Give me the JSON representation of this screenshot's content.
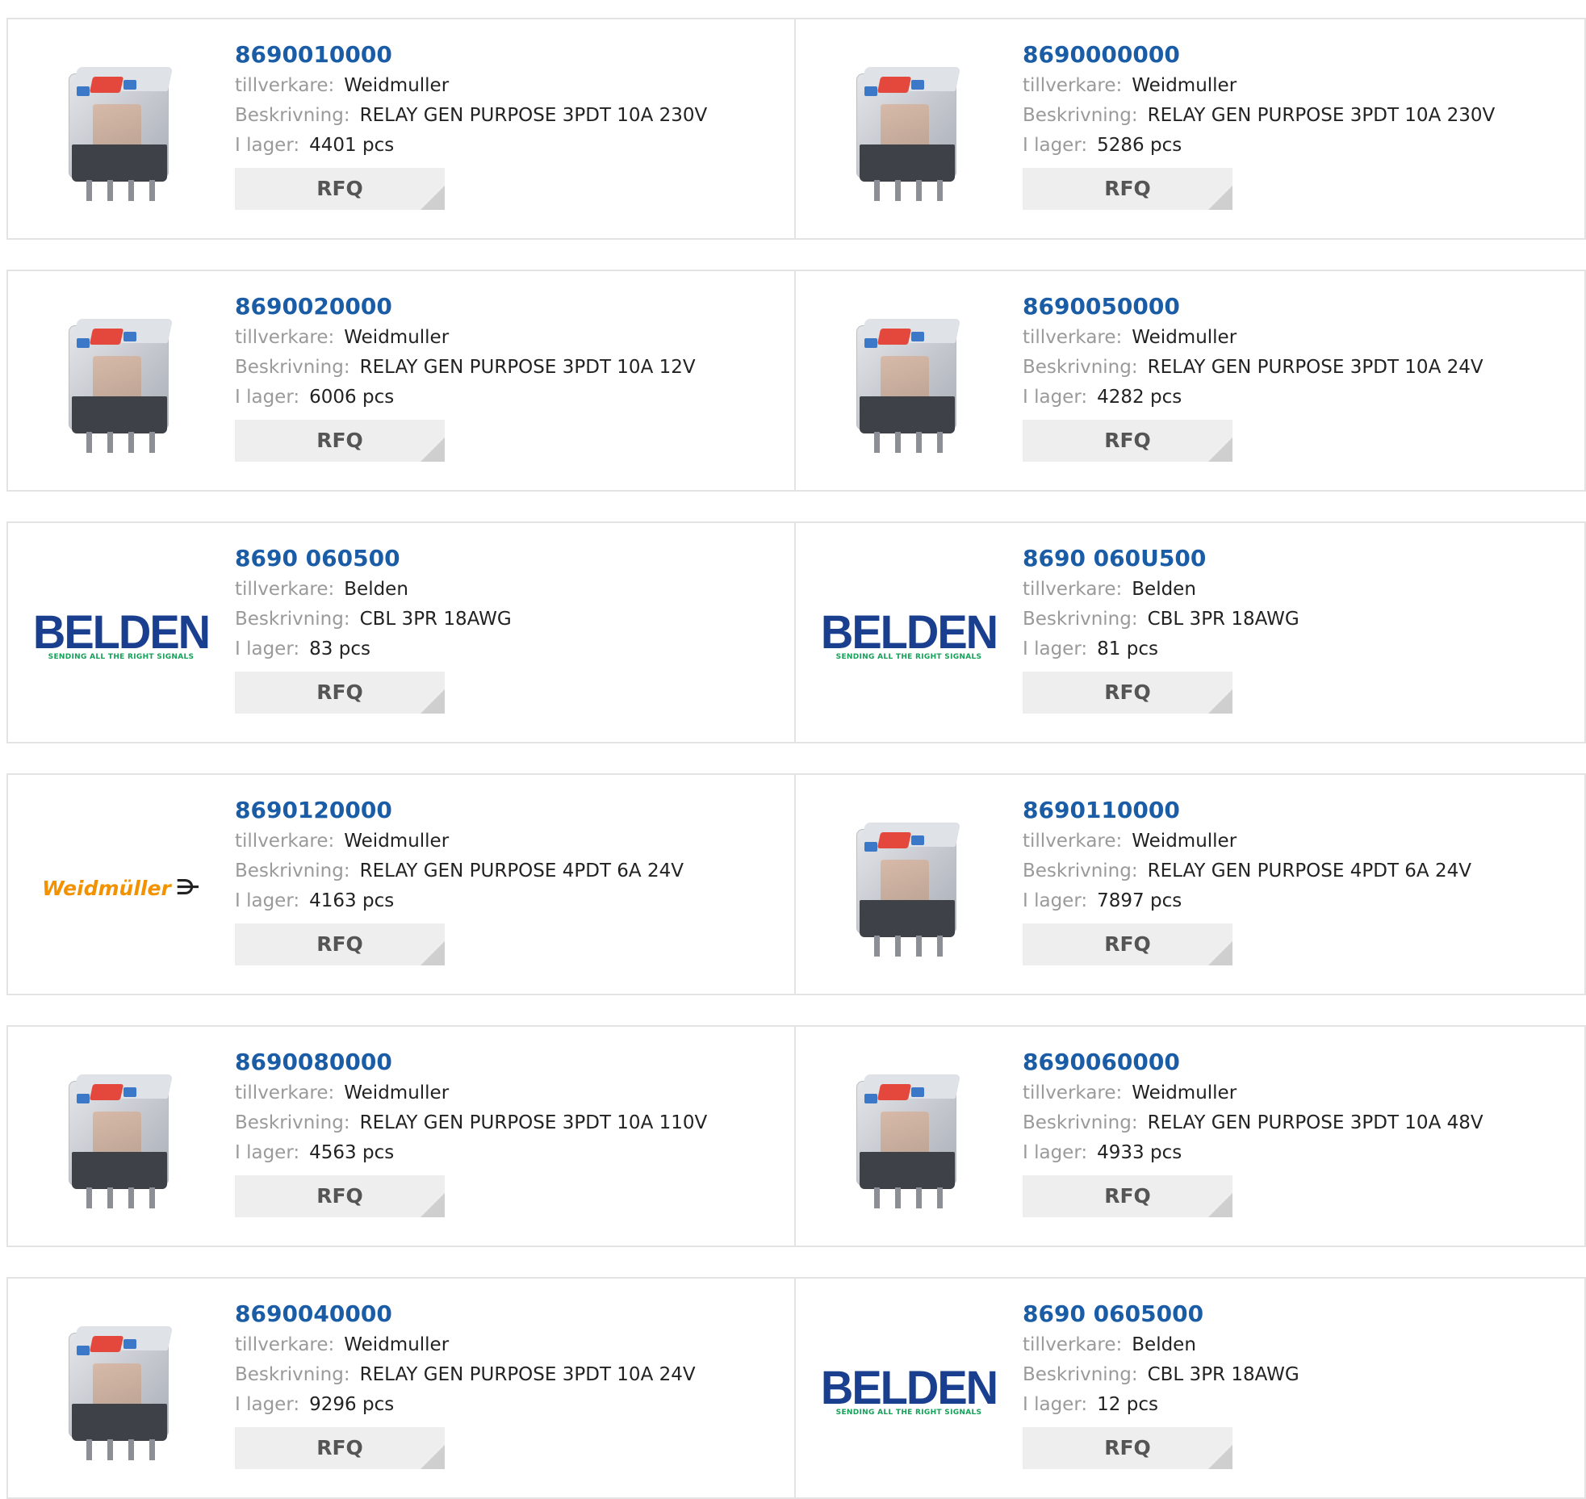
{
  "labels": {
    "manufacturer": "tillverkare:",
    "description": "Beskrivning:",
    "stock": "I lager:"
  },
  "rfq_label": "RFQ",
  "logos": {
    "belden_name": "BELDEN",
    "belden_tagline": "SENDING ALL THE RIGHT SIGNALS",
    "weidmuller_name": "Weidmüller",
    "weidmuller_symbol": "⋺"
  },
  "colors": {
    "part_link": "#1a5da6",
    "rfq_bg": "#eeeeee",
    "border": "#e3e3e3"
  },
  "products": [
    {
      "part": "8690010000",
      "manufacturer": "Weidmuller",
      "description": "RELAY GEN PURPOSE 3PDT 10A 230V",
      "stock": "4401 pcs",
      "image": "relay"
    },
    {
      "part": "8690000000",
      "manufacturer": "Weidmuller",
      "description": "RELAY GEN PURPOSE 3PDT 10A 230V",
      "stock": "5286 pcs",
      "image": "relay"
    },
    {
      "part": "8690020000",
      "manufacturer": "Weidmuller",
      "description": "RELAY GEN PURPOSE 3PDT 10A 12V",
      "stock": "6006 pcs",
      "image": "relay"
    },
    {
      "part": "8690050000",
      "manufacturer": "Weidmuller",
      "description": "RELAY GEN PURPOSE 3PDT 10A 24V",
      "stock": "4282 pcs",
      "image": "relay"
    },
    {
      "part": "8690 060500",
      "manufacturer": "Belden",
      "description": "CBL 3PR 18AWG",
      "stock": "83 pcs",
      "image": "belden"
    },
    {
      "part": "8690 060U500",
      "manufacturer": "Belden",
      "description": "CBL 3PR 18AWG",
      "stock": "81 pcs",
      "image": "belden"
    },
    {
      "part": "8690120000",
      "manufacturer": "Weidmuller",
      "description": "RELAY GEN PURPOSE 4PDT 6A 24V",
      "stock": "4163 pcs",
      "image": "weidmuller"
    },
    {
      "part": "8690110000",
      "manufacturer": "Weidmuller",
      "description": "RELAY GEN PURPOSE 4PDT 6A 24V",
      "stock": "7897 pcs",
      "image": "relay"
    },
    {
      "part": "8690080000",
      "manufacturer": "Weidmuller",
      "description": "RELAY GEN PURPOSE 3PDT 10A 110V",
      "stock": "4563 pcs",
      "image": "relay"
    },
    {
      "part": "8690060000",
      "manufacturer": "Weidmuller",
      "description": "RELAY GEN PURPOSE 3PDT 10A 48V",
      "stock": "4933 pcs",
      "image": "relay"
    },
    {
      "part": "8690040000",
      "manufacturer": "Weidmuller",
      "description": "RELAY GEN PURPOSE 3PDT 10A 24V",
      "stock": "9296 pcs",
      "image": "relay"
    },
    {
      "part": "8690 0605000",
      "manufacturer": "Belden",
      "description": "CBL 3PR 18AWG",
      "stock": "12 pcs",
      "image": "belden"
    }
  ]
}
